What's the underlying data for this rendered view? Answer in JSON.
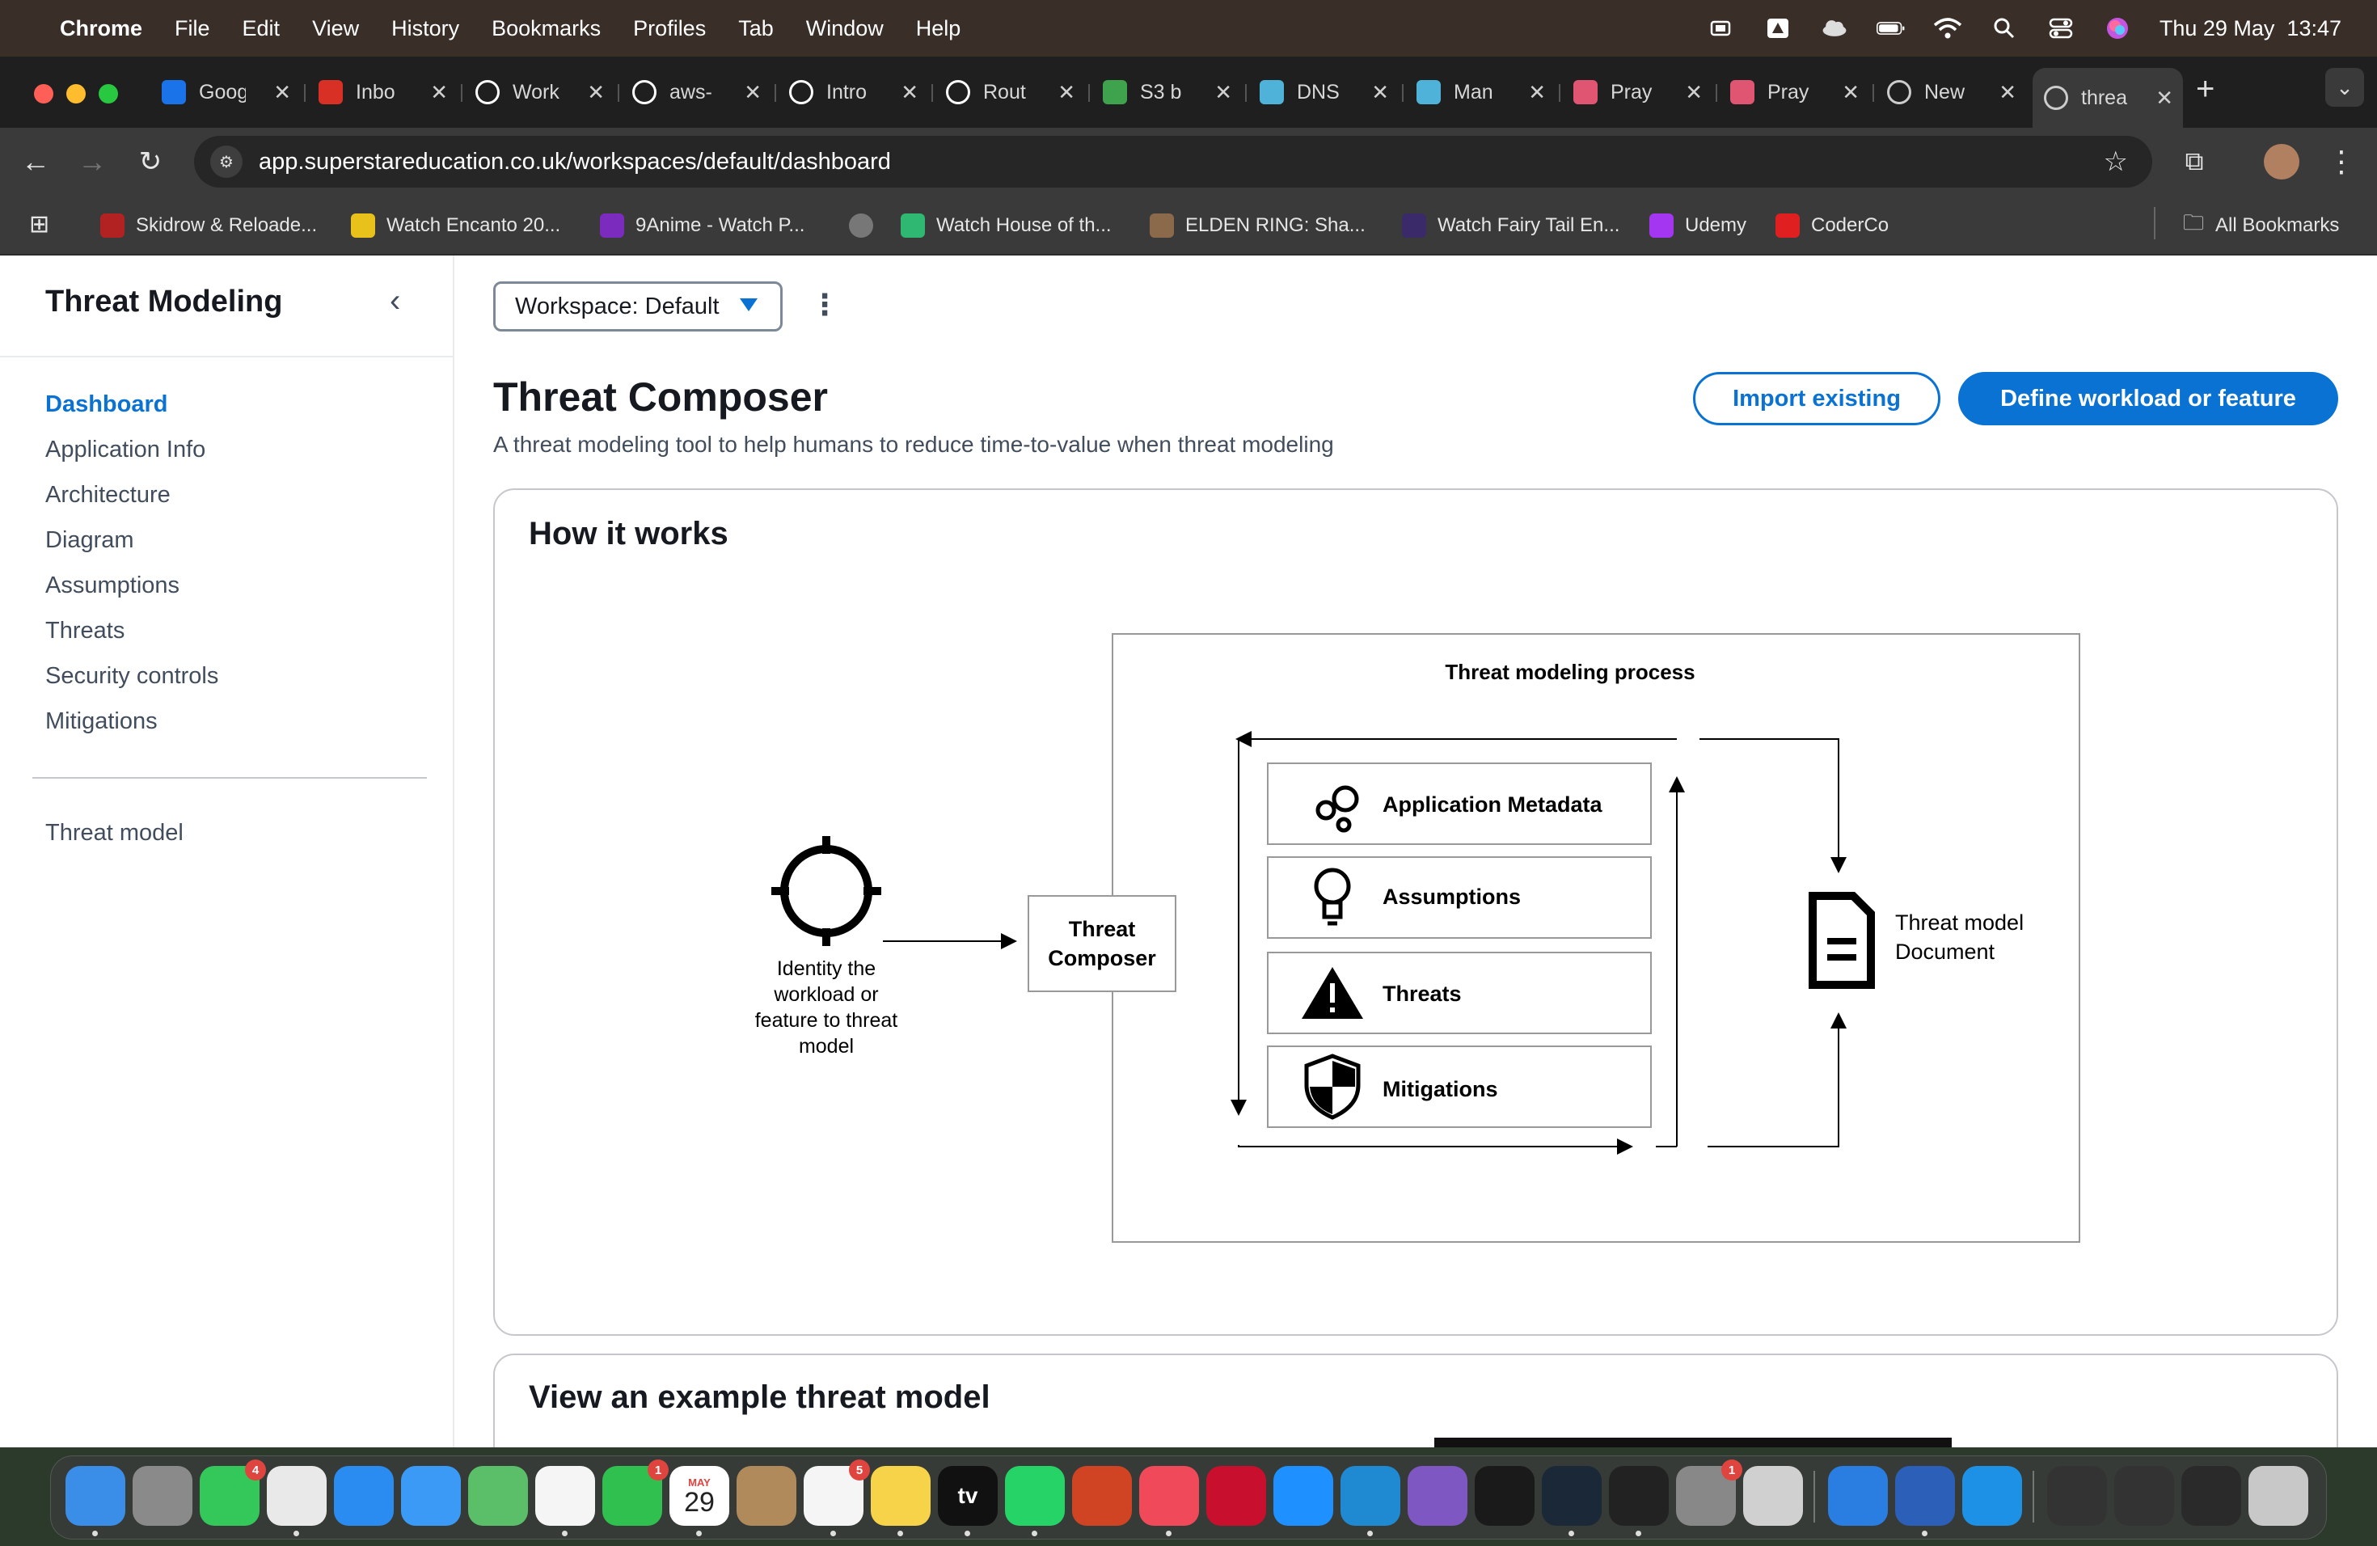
{
  "menubar": {
    "app": "Chrome",
    "items": [
      "File",
      "Edit",
      "View",
      "History",
      "Bookmarks",
      "Profiles",
      "Tab",
      "Window",
      "Help"
    ],
    "datetime": "Thu 29 May  13:47"
  },
  "tabs": [
    {
      "title": "Goog",
      "icon": "google-calendar-icon",
      "color": "#1a73e8"
    },
    {
      "title": "Inbo",
      "icon": "gmail-icon",
      "color": "#d93025"
    },
    {
      "title": "Work",
      "icon": "github-icon",
      "color": "#ffffff"
    },
    {
      "title": "aws-",
      "icon": "github-icon",
      "color": "#ffffff"
    },
    {
      "title": "Intro",
      "icon": "openai-icon",
      "color": "#ffffff"
    },
    {
      "title": "Rout",
      "icon": "openai-icon",
      "color": "#ffffff"
    },
    {
      "title": "S3 b",
      "icon": "aws-icon",
      "color": "#3fa34d"
    },
    {
      "title": "DNS",
      "icon": "cloudflare-icon",
      "color": "#4fb3d9"
    },
    {
      "title": "Man",
      "icon": "cloudflare-icon",
      "color": "#4fb3d9"
    },
    {
      "title": "Pray",
      "icon": "flower-icon",
      "color": "#e05572"
    },
    {
      "title": "Pray",
      "icon": "flower-icon",
      "color": "#e05572"
    },
    {
      "title": "New",
      "icon": "chrome-icon",
      "color": "#cccccc"
    },
    {
      "title": "threa",
      "icon": "globe-icon",
      "color": "#cccccc",
      "active": true
    }
  ],
  "address": {
    "url": "app.superstareducation.co.uk/workspaces/default/dashboard"
  },
  "bookmarks": [
    {
      "label": "Skidrow & Reloade...",
      "color": "#b22222"
    },
    {
      "label": "Watch Encanto 20...",
      "color": "#e8c21a"
    },
    {
      "label": "9Anime - Watch P...",
      "color": "#7b2cbf"
    },
    {
      "label": "",
      "color": "#777777"
    },
    {
      "label": "Watch House of th...",
      "color": "#2eb872"
    },
    {
      "label": "ELDEN RING: Sha...",
      "color": "#8a6a4a"
    },
    {
      "label": "Watch Fairy Tail En...",
      "color": "#3a2a6a"
    },
    {
      "label": "Udemy",
      "color": "#a435f0"
    },
    {
      "label": "CoderCo",
      "color": "#e02020"
    }
  ],
  "all_bookmarks": "All Bookmarks",
  "sidebar": {
    "title": "Threat Modeling",
    "items": [
      "Dashboard",
      "Application Info",
      "Architecture",
      "Diagram",
      "Assumptions",
      "Threats",
      "Security controls",
      "Mitigations"
    ],
    "footer_item": "Threat model"
  },
  "workspace": {
    "label": "Workspace: Default"
  },
  "header": {
    "title": "Threat Composer",
    "description": "A threat modeling tool to help humans to reduce time-to-value when threat modeling",
    "import_button": "Import existing",
    "define_button": "Define workload or feature"
  },
  "how_it_works": {
    "title": "How it works",
    "diagram": {
      "process_title": "Threat modeling process",
      "identify_text": [
        "Identity the",
        "workload or",
        "feature to threat",
        "model"
      ],
      "composer_box": [
        "Threat",
        "Composer"
      ],
      "steps": [
        "Application Metadata",
        "Assumptions",
        "Threats",
        "Mitigations"
      ],
      "output": [
        "Threat model",
        "Document"
      ]
    }
  },
  "example": {
    "title": "View an example threat model"
  },
  "dock": {
    "badges": {
      "messages": "4",
      "facetime": "1",
      "reminders": "5",
      "settings": "1"
    },
    "calendar": {
      "month": "MAY",
      "day": "29"
    },
    "tv_label": "tv"
  }
}
